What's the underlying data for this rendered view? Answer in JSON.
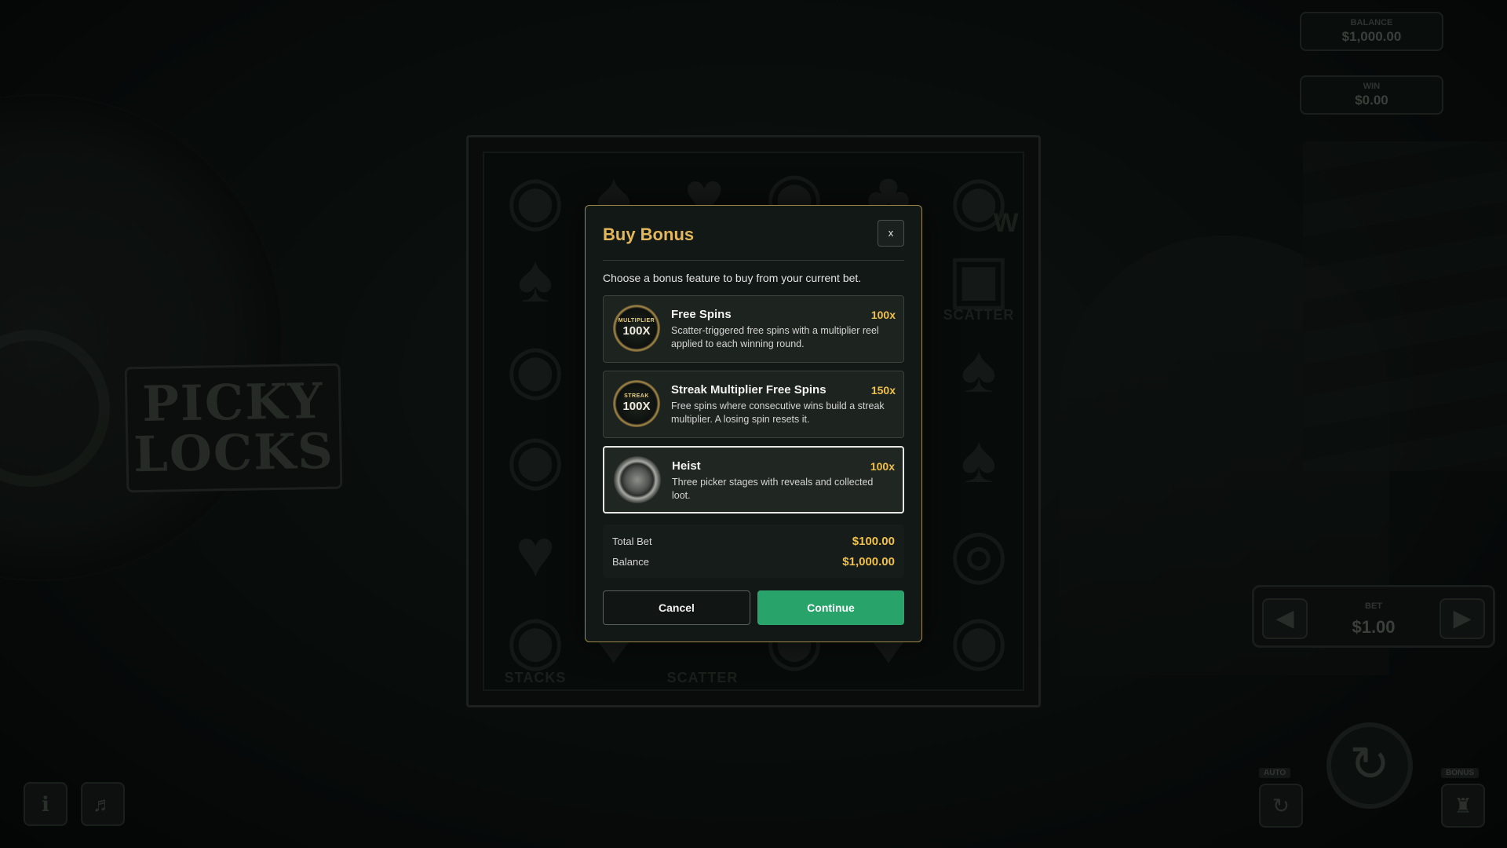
{
  "background": {
    "logo_line1": "PICKY",
    "logo_line2": "LOCKS"
  },
  "hud": {
    "balance_label": "BALANCE",
    "balance_value": "$1,000.00",
    "win_label": "WIN",
    "win_value": "$0.00",
    "bet_label": "BET",
    "bet_value": "$1.00",
    "auto_label": "AUTO",
    "bonus_label": "BONUS"
  },
  "reels": {
    "scatter_label": "SCATTER",
    "stacks_label": "STACKS",
    "wild_label": "W"
  },
  "modal": {
    "title": "Buy Bonus",
    "close_label": "x",
    "subtitle": "Choose a bonus feature to buy from your current bet.",
    "options": [
      {
        "name": "Free Spins",
        "multiplier": "100x",
        "description": "Scatter-triggered free spins with a multiplier reel applied to each winning round.",
        "icon": "multiplier-coin-icon",
        "icon_top": "MULTIPLIER",
        "icon_main": "100X"
      },
      {
        "name": "Streak Multiplier Free Spins",
        "multiplier": "150x",
        "description": "Free spins where consecutive wins build a streak multiplier. A losing spin resets it.",
        "icon": "streak-coin-icon",
        "icon_top": "STREAK",
        "icon_main": "100X"
      },
      {
        "name": "Heist",
        "multiplier": "100x",
        "description": "Three picker stages with reveals and collected loot.",
        "icon": "safe-dial-icon",
        "selected": true
      }
    ],
    "summary": {
      "total_bet_label": "Total Bet",
      "total_bet_value": "$100.00",
      "balance_label": "Balance",
      "balance_value": "$1,000.00"
    },
    "cancel_label": "Cancel",
    "continue_label": "Continue"
  },
  "colors": {
    "accent_gold": "#e4b85a",
    "value_gold": "#f0c048",
    "continue_green": "#28a46b",
    "modal_border": "#9d8a4a"
  }
}
